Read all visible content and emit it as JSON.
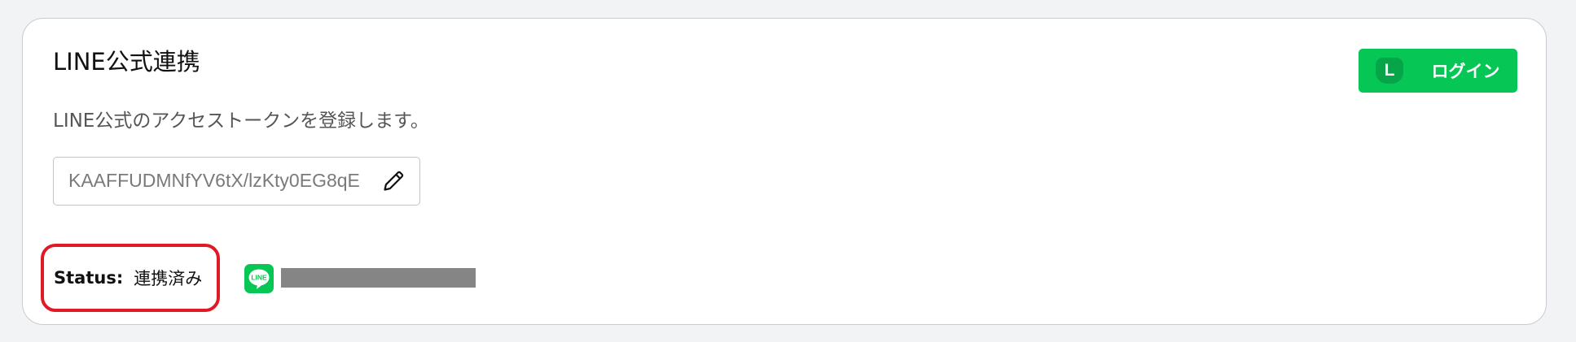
{
  "card": {
    "title": "LINE公式連携",
    "description": "LINE公式のアクセストークンを登録します。",
    "login_button": {
      "icon_letter": "L",
      "label": "ログイン"
    },
    "token_field": {
      "value": "KAAFFUDMNfYV6tX/lzKty0EG8qE"
    },
    "status": {
      "label": "Status:",
      "value": "連携済み"
    },
    "line_icon_text": "LINE"
  },
  "colors": {
    "line_green": "#06c755",
    "status_highlight": "#e01a24",
    "redaction": "#858585"
  },
  "icons": [
    "pencil-icon",
    "line-logo-icon",
    "line-app-icon"
  ]
}
